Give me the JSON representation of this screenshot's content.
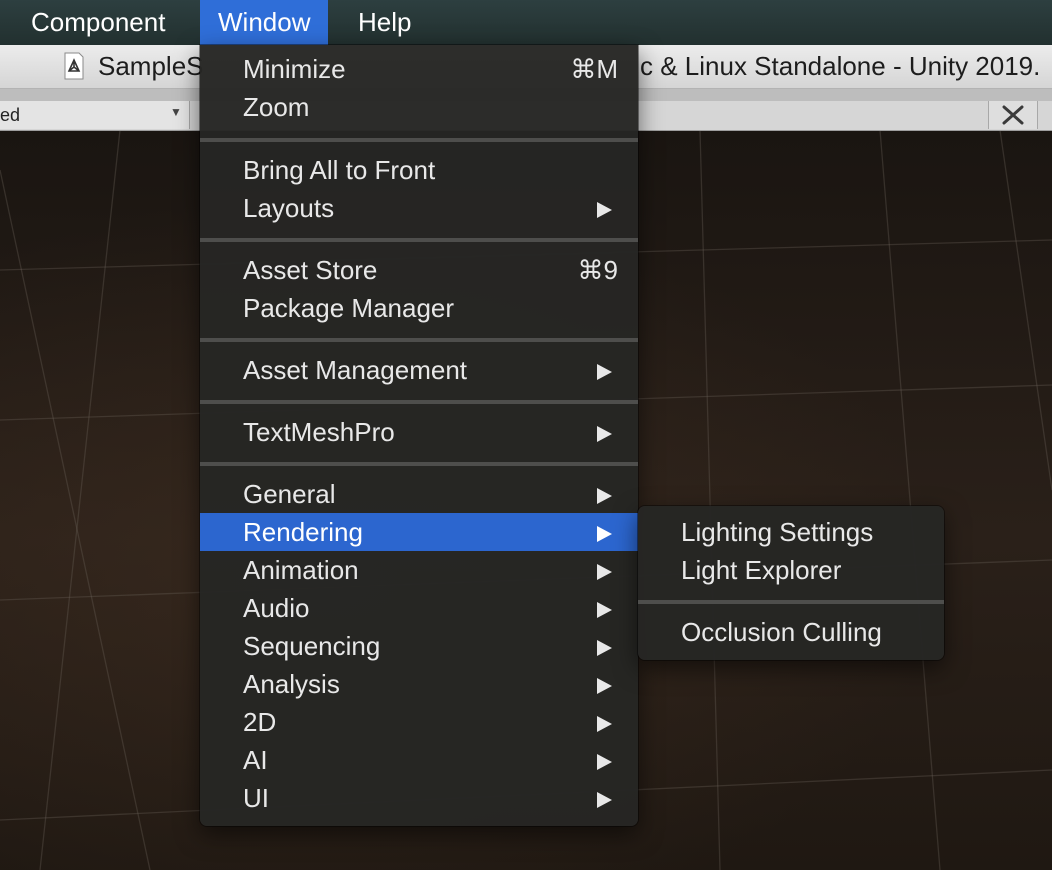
{
  "menubar": {
    "items": [
      {
        "label": "Component"
      },
      {
        "label": "Window"
      },
      {
        "label": "Help"
      }
    ]
  },
  "titlebar": {
    "title_left": "SampleS",
    "title_right": "c & Linux Standalone - Unity 2019."
  },
  "toolbar": {
    "dropdown_label": "ed"
  },
  "window_menu": {
    "items": [
      {
        "label": "Minimize",
        "shortcut": "⌘M"
      },
      {
        "label": "Zoom"
      },
      {
        "label": "Bring All to Front"
      },
      {
        "label": "Layouts"
      },
      {
        "label": "Asset Store",
        "shortcut": "⌘9"
      },
      {
        "label": "Package Manager"
      },
      {
        "label": "Asset Management"
      },
      {
        "label": "TextMeshPro"
      },
      {
        "label": "General"
      },
      {
        "label": "Rendering"
      },
      {
        "label": "Animation"
      },
      {
        "label": "Audio"
      },
      {
        "label": "Sequencing"
      },
      {
        "label": "Analysis"
      },
      {
        "label": "2D"
      },
      {
        "label": "AI"
      },
      {
        "label": "UI"
      }
    ]
  },
  "rendering_submenu": {
    "items": [
      {
        "label": "Lighting Settings"
      },
      {
        "label": "Light Explorer"
      },
      {
        "label": "Occlusion Culling"
      }
    ]
  },
  "colors": {
    "menubar_active": "#2f6ed8",
    "menu_highlight": "#2c66cf",
    "menu_background": "#262624"
  },
  "icons": {
    "unity_logo": "unity-icon",
    "submenu_arrow": "submenu-arrow-icon",
    "tools": "tools-icon",
    "dropdown_caret": "dropdown-caret-icon"
  }
}
